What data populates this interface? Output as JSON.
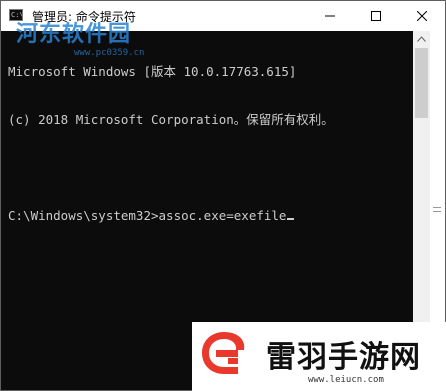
{
  "window": {
    "title": "管理员: 命令提示符",
    "icon_label": "C:\\",
    "buttons": {
      "minimize": "minimize-icon",
      "maximize": "maximize-icon",
      "close": "close-icon"
    }
  },
  "console": {
    "lines": [
      "Microsoft Windows [版本 10.0.17763.615]",
      "(c) 2018 Microsoft Corporation。保留所有权利。",
      "",
      "C:\\Windows\\system32>assoc.exe=exefile"
    ],
    "background": "#0c0c0c",
    "foreground": "#cccccc"
  },
  "watermarks": {
    "top_text": "河东软件园",
    "top_url": "www.pc0359.cn",
    "bottom_title": "雷羽手游网",
    "bottom_url": "www.leiucn.com",
    "logo_color": "#e8392c"
  }
}
